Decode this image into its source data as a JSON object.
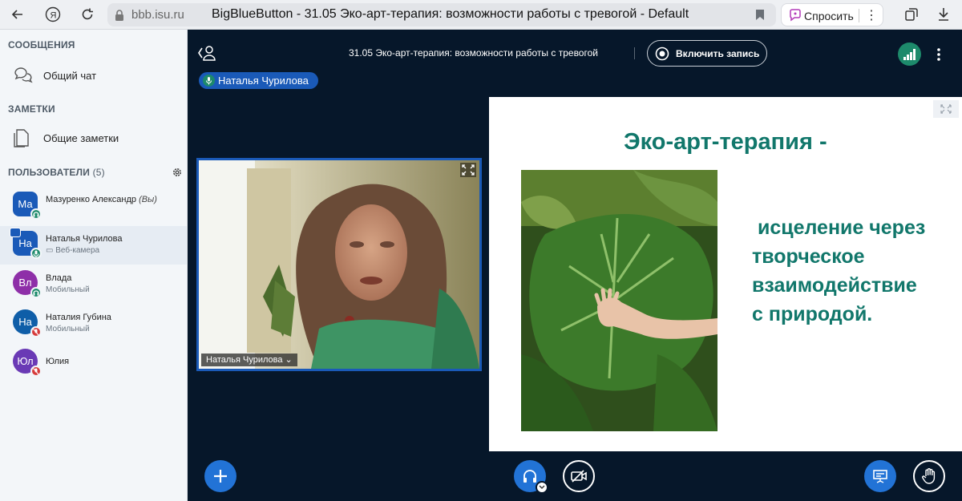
{
  "browser": {
    "host": "bbb.isu.ru",
    "tab_title": "BigBlueButton - 31.05 Эко-арт-терапия: возможности работы с тревогой - Default",
    "ask_label": "Спросить"
  },
  "sidebar": {
    "messages_title": "СООБЩЕНИЯ",
    "public_chat": "Общий чат",
    "notes_title": "ЗАМЕТКИ",
    "shared_notes": "Общие заметки",
    "users_title": "ПОЛЬЗОВАТЕЛИ",
    "users_count": "(5)",
    "users": [
      {
        "initials": "Ма",
        "name": "Мазуренко Александр",
        "you": "(Вы)",
        "sub": "",
        "color": "#1a5ab8",
        "badge": "#1d8a6b",
        "shape": "square"
      },
      {
        "initials": "На",
        "name": "Наталья Чурилова",
        "you": "",
        "sub": "▭ Веб-камера",
        "color": "#1a5ab8",
        "badge": "#1d8a6b",
        "shape": "square"
      },
      {
        "initials": "Вл",
        "name": "Влада",
        "you": "",
        "sub": "Мобильный",
        "color": "#8e2fa8",
        "badge": "#1d8a6b",
        "shape": "round"
      },
      {
        "initials": "На",
        "name": "Наталия Губина",
        "you": "",
        "sub": "Мобильный",
        "color": "#0f5ea8",
        "badge": "#d63b3b",
        "shape": "round"
      },
      {
        "initials": "Юл",
        "name": "Юлия",
        "you": "",
        "sub": "",
        "color": "#6a3ab5",
        "badge": "#d63b3b",
        "shape": "round"
      }
    ]
  },
  "header": {
    "meeting_title": "31.05 Эко-арт-терапия: возможности работы с тревогой",
    "record_label": "Включить запись"
  },
  "talking": {
    "name": "Наталья Чурилова"
  },
  "video": {
    "name_tag": "Наталья Чурилова ⌄"
  },
  "slide": {
    "title": "Эко-арт-терапия -",
    "text": " исцеление через\nтворческое\nвзаимодействие\nс природой."
  },
  "colors": {
    "accent": "#1a5ab8",
    "button_blue": "#2273d6",
    "slide_text": "#11776b",
    "background": "#06172a"
  }
}
